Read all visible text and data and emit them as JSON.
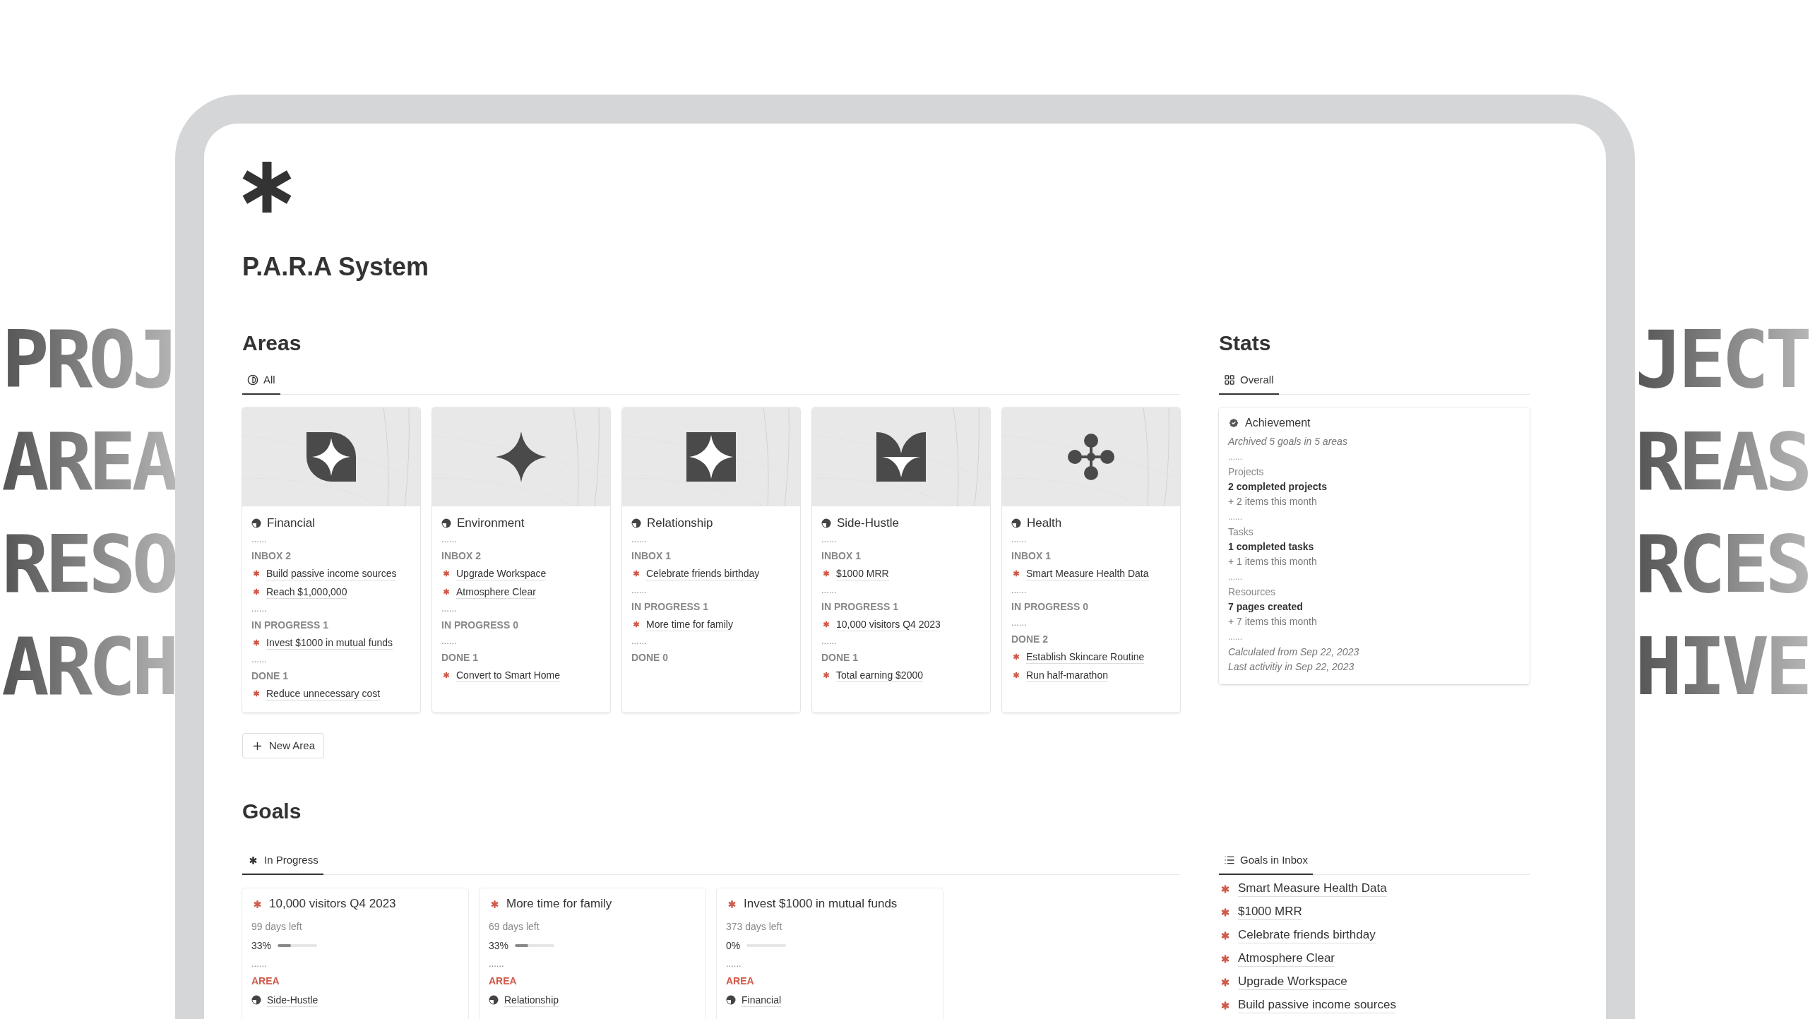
{
  "background_words": {
    "left": [
      "PROJ",
      "AREA",
      "RESO",
      "ARCH"
    ],
    "right": [
      "JECT",
      "REAS",
      "RCES",
      "HIVE"
    ]
  },
  "page": {
    "title": "P.A.R.A System"
  },
  "areas": {
    "heading": "Areas",
    "tabs": [
      {
        "label": "All",
        "selected": true
      }
    ],
    "cards": [
      {
        "name": "Financial",
        "lines": [
          {
            "kind": "separator",
            "text": "......"
          },
          {
            "kind": "status",
            "text": "INBOX 2"
          },
          {
            "kind": "goal",
            "text": "Build passive income sources"
          },
          {
            "kind": "goal",
            "text": "Reach $1,000,000"
          },
          {
            "kind": "separator",
            "text": "......"
          },
          {
            "kind": "status",
            "text": "IN PROGRESS 1"
          },
          {
            "kind": "goal",
            "text": "Invest $1000 in mutual funds"
          },
          {
            "kind": "separator",
            "text": "......"
          },
          {
            "kind": "status",
            "text": "DONE 1"
          },
          {
            "kind": "goal",
            "text": "Reduce unnecessary cost"
          }
        ]
      },
      {
        "name": "Environment",
        "lines": [
          {
            "kind": "separator",
            "text": "......"
          },
          {
            "kind": "status",
            "text": "INBOX 2"
          },
          {
            "kind": "goal",
            "text": "Upgrade Workspace"
          },
          {
            "kind": "goal",
            "text": "Atmosphere Clear"
          },
          {
            "kind": "separator",
            "text": "......"
          },
          {
            "kind": "status",
            "text": "IN PROGRESS 0"
          },
          {
            "kind": "separator",
            "text": "......"
          },
          {
            "kind": "status",
            "text": "DONE 1"
          },
          {
            "kind": "goal",
            "text": "Convert to Smart Home"
          }
        ]
      },
      {
        "name": "Relationship",
        "lines": [
          {
            "kind": "separator",
            "text": "......"
          },
          {
            "kind": "status",
            "text": "INBOX 1"
          },
          {
            "kind": "goal",
            "text": "Celebrate friends birthday"
          },
          {
            "kind": "separator",
            "text": "......"
          },
          {
            "kind": "status",
            "text": "IN PROGRESS 1"
          },
          {
            "kind": "goal",
            "text": "More time for family"
          },
          {
            "kind": "separator",
            "text": "......"
          },
          {
            "kind": "status",
            "text": "DONE 0"
          }
        ]
      },
      {
        "name": "Side-Hustle",
        "lines": [
          {
            "kind": "separator",
            "text": "......"
          },
          {
            "kind": "status",
            "text": "INBOX 1"
          },
          {
            "kind": "goal",
            "text": "$1000 MRR"
          },
          {
            "kind": "separator",
            "text": "......"
          },
          {
            "kind": "status",
            "text": "IN PROGRESS 1"
          },
          {
            "kind": "goal",
            "text": "10,000 visitors Q4 2023"
          },
          {
            "kind": "separator",
            "text": "......"
          },
          {
            "kind": "status",
            "text": "DONE 1"
          },
          {
            "kind": "goal",
            "text": "Total earning $2000"
          }
        ]
      },
      {
        "name": "Health",
        "lines": [
          {
            "kind": "separator",
            "text": "......"
          },
          {
            "kind": "status",
            "text": "INBOX 1"
          },
          {
            "kind": "goal",
            "text": "Smart Measure Health Data"
          },
          {
            "kind": "separator",
            "text": "......"
          },
          {
            "kind": "status",
            "text": "IN PROGRESS 0"
          },
          {
            "kind": "separator",
            "text": "......"
          },
          {
            "kind": "status",
            "text": "DONE 2"
          },
          {
            "kind": "goal",
            "text": "Establish Skincare Routine"
          },
          {
            "kind": "goal",
            "text": "Run half-marathon"
          }
        ]
      }
    ],
    "new_button": "New Area"
  },
  "stats": {
    "heading": "Stats",
    "tabs": [
      {
        "label": "Overall",
        "selected": true
      }
    ],
    "card": {
      "title": "Achievement",
      "lines": [
        {
          "kind": "note",
          "text": "Archived 5 goals in 5 areas"
        },
        {
          "kind": "separator",
          "text": "......"
        },
        {
          "kind": "label",
          "text": "Projects"
        },
        {
          "kind": "value",
          "text": "2 completed projects"
        },
        {
          "kind": "delta",
          "text": "+ 2 items this month"
        },
        {
          "kind": "separator",
          "text": "......"
        },
        {
          "kind": "label",
          "text": "Tasks"
        },
        {
          "kind": "value",
          "text": "1 completed tasks"
        },
        {
          "kind": "delta",
          "text": "+ 1 items this month"
        },
        {
          "kind": "separator",
          "text": "......"
        },
        {
          "kind": "label",
          "text": "Resources"
        },
        {
          "kind": "value",
          "text": "7 pages created"
        },
        {
          "kind": "delta",
          "text": "+ 7 items this month"
        },
        {
          "kind": "separator",
          "text": "......"
        },
        {
          "kind": "note",
          "text": "Calculated from Sep 22, 2023"
        },
        {
          "kind": "note",
          "text": "Last activitiy in Sep 22, 2023"
        }
      ]
    }
  },
  "goals": {
    "heading": "Goals",
    "tabs": [
      {
        "label": "In Progress",
        "selected": true
      }
    ],
    "cards": [
      {
        "title": "10,000 visitors Q4 2023",
        "days_left": "99 days left",
        "percent": "33%",
        "level": 0.33,
        "separator": "......",
        "area_label": "AREA",
        "area": "Side-Hustle"
      },
      {
        "title": "More time for family",
        "days_left": "69 days left",
        "percent": "33%",
        "level": 0.33,
        "separator": "......",
        "area_label": "AREA",
        "area": "Relationship"
      },
      {
        "title": "Invest $1000 in mutual funds",
        "days_left": "373 days left",
        "percent": "0%",
        "level": 0,
        "separator": "......",
        "area_label": "AREA",
        "area": "Financial"
      }
    ]
  },
  "inbox": {
    "tabs": [
      {
        "label": "Goals in Inbox",
        "selected": true
      }
    ],
    "items": [
      "Smart Measure Health Data",
      "$1000 MRR",
      "Celebrate friends birthday",
      "Atmosphere Clear",
      "Upgrade Workspace",
      "Build passive income sources"
    ]
  }
}
